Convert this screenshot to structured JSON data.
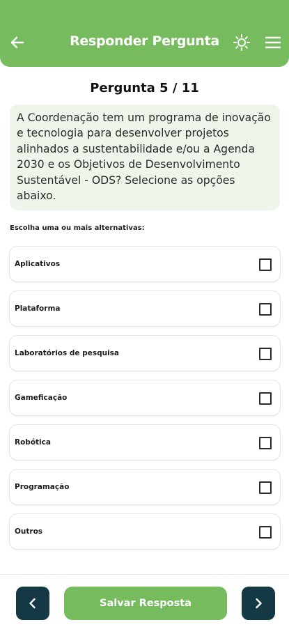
{
  "header": {
    "title": "Responder Pergunta",
    "back_icon": "arrow-left-icon",
    "theme_icon": "sun-icon",
    "menu_icon": "hamburger-menu-icon",
    "color": "#76bb5e"
  },
  "question": {
    "counter": "Pergunta 5 / 11",
    "text": "A Coordenação tem um programa de inovação e tecnologia para desenvolver projetos alinhados a sustentabilidade e/ou a Agenda 2030 e os Objetivos de Desenvolvimento Sustentável - ODS? Selecione as opções abaixo."
  },
  "instruction": "Escolha uma ou mais alternativas:",
  "options": [
    {
      "label": "Aplicativos",
      "checked": false
    },
    {
      "label": "Plataforma",
      "checked": false
    },
    {
      "label": "Laboratórios de pesquisa",
      "checked": false
    },
    {
      "label": "Gameficação",
      "checked": false
    },
    {
      "label": "Robótica",
      "checked": false
    },
    {
      "label": "Programação",
      "checked": false
    },
    {
      "label": "Outros",
      "checked": false
    }
  ],
  "footer": {
    "save_label": "Salvar Resposta",
    "prev_icon": "chevron-left-icon",
    "next_icon": "chevron-right-icon",
    "nav_color": "#143844"
  }
}
